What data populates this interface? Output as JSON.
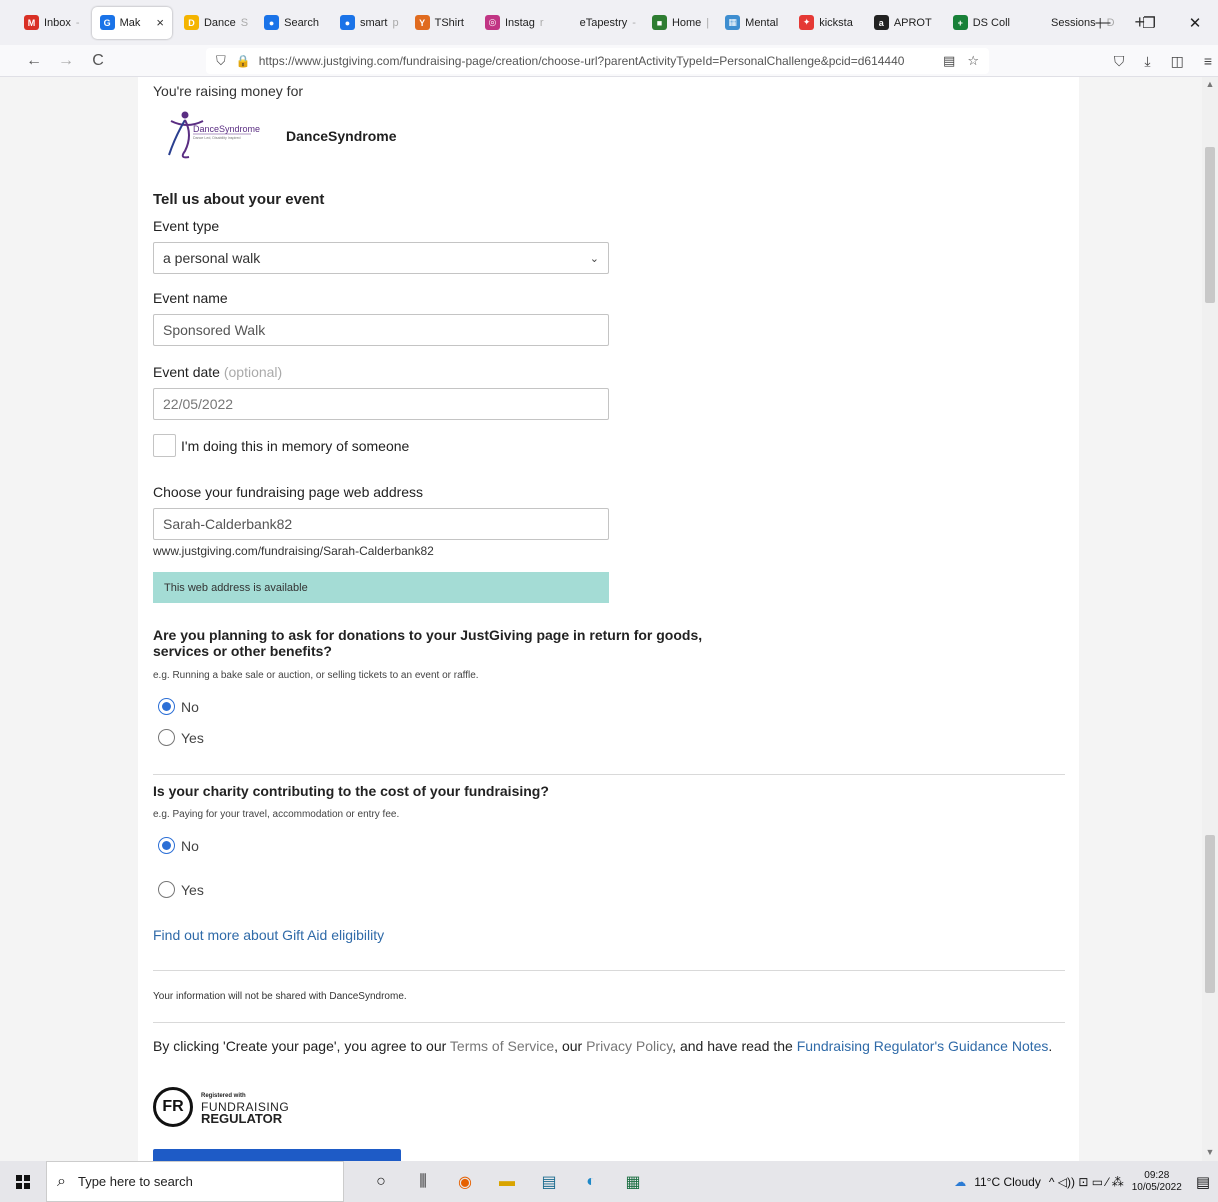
{
  "browser": {
    "tabs": [
      {
        "label": "Inbox",
        "fade": " -",
        "icon_text": "M",
        "icon_color": "#d93025",
        "active": false
      },
      {
        "label": "Mak",
        "fade": "",
        "icon_text": "G",
        "icon_color": "#1a73e8",
        "active": true
      },
      {
        "label": "Dance",
        "fade": "S",
        "icon_text": "D",
        "icon_color": "#f4b400",
        "active": false
      },
      {
        "label": "Search",
        "fade": "",
        "icon_text": "●",
        "icon_color": "#1a73e8",
        "active": false
      },
      {
        "label": "smart",
        "fade": "p",
        "icon_text": "●",
        "icon_color": "#1a73e8",
        "active": false
      },
      {
        "label": "TShirt",
        "fade": "",
        "icon_text": "Y",
        "icon_color": "#e06b1f",
        "active": false
      },
      {
        "label": "Instag",
        "fade": "r",
        "icon_text": "◎",
        "icon_color": "#c13584",
        "active": false
      },
      {
        "label": "eTapestry",
        "fade": " -",
        "icon_text": "",
        "icon_color": "#f0f0f4",
        "active": false
      },
      {
        "label": "Home",
        "fade": " |",
        "icon_text": "■",
        "icon_color": "#2e7d32",
        "active": false
      },
      {
        "label": "Mental",
        "fade": "",
        "icon_text": "▦",
        "icon_color": "#3e8ed0",
        "active": false
      },
      {
        "label": "kicksta",
        "fade": "",
        "icon_text": "✦",
        "icon_color": "#e53935",
        "active": false
      },
      {
        "label": "APROT",
        "fade": "",
        "icon_text": "a",
        "icon_color": "#222222",
        "active": false
      },
      {
        "label": "DS Coll",
        "fade": "",
        "icon_text": "+",
        "icon_color": "#188038",
        "active": false
      },
      {
        "label": "Sessions |",
        "fade": " D",
        "icon_text": "",
        "icon_color": "#f0f0f4",
        "active": false
      }
    ],
    "close_glyph": "×",
    "new_tab_glyph": "+",
    "window_controls": [
      "—",
      "❐",
      "✕"
    ],
    "url": "https://www.justgiving.com/fundraising-page/creation/choose-url?parentActivityTypeId=PersonalChallenge&pcid=d614440",
    "nav": {
      "back": "←",
      "forward": "→",
      "reload": "C"
    },
    "url_icons": {
      "shield": "⛉",
      "lock": "🔒",
      "reader": "▤",
      "star": "☆"
    },
    "right_icons": [
      "⛉",
      "⤓",
      "◫",
      "≡"
    ]
  },
  "page": {
    "raising_label": "You're raising money for",
    "charity_name": "DanceSyndrome",
    "charity_logo_text": "DanceSyndrome",
    "charity_logo_tagline": "Dance Led, Disability Inspired",
    "section_title": "Tell us about your event",
    "event_type_label": "Event type",
    "event_type_value": "a personal walk",
    "event_name_label": "Event name",
    "event_name_value": "Sponsored Walk",
    "event_date_label": "Event date",
    "event_date_optional": "(optional)",
    "event_date_value": "22/05/2022",
    "memory_label": "I'm doing this in memory of someone",
    "web_address_label": "Choose your fundraising page web address",
    "web_address_value": "Sarah-Calderbank82",
    "web_address_preview": "www.justgiving.com/fundraising/Sarah-Calderbank82",
    "availability_message": "This web address is available",
    "q1_title": "Are you planning to ask for donations to your JustGiving page in return for goods, services or other benefits?",
    "q1_example": "e.g. Running a bake sale or auction, or selling tickets to an event or raffle.",
    "q1_options": [
      {
        "label": "No",
        "selected": true
      },
      {
        "label": "Yes",
        "selected": false
      }
    ],
    "q2_title": "Is your charity contributing to the cost of your fundraising?",
    "q2_example": "e.g. Paying for your travel, accommodation or entry fee.",
    "q2_options": [
      {
        "label": "No",
        "selected": true
      },
      {
        "label": "Yes",
        "selected": false
      }
    ],
    "gift_aid_link": "Find out more about Gift Aid eligibility",
    "privacy_note": "Your information will not be shared with DanceSyndrome.",
    "terms": {
      "prefix": "By clicking 'Create your page', you agree to our ",
      "tos": "Terms of Service",
      "mid1": ", our ",
      "privacy": "Privacy Policy",
      "mid2": ", and have read the ",
      "guidance": "Fundraising Regulator's Guidance Notes",
      "suffix": "."
    },
    "regulator": {
      "mark": "FR",
      "registered": "Registered with",
      "line1": "FUNDRAISING",
      "line2": "REGULATOR"
    }
  },
  "taskbar": {
    "search_placeholder": "Type here to search",
    "search_icon": "⌕",
    "apps": [
      "○",
      "⫼",
      "◉",
      "▬",
      "▤",
      "◐",
      "▦"
    ],
    "weather": "11°C  Cloudy",
    "tray_icons": "^ ◁)) ⊡ ▭ ⁄ ⁂",
    "time": "09:28",
    "date": "10/05/2022",
    "notif_icon": "▤"
  },
  "colors": {
    "accent": "#1e5bc6",
    "link": "#2f6aa8",
    "available_bg": "#a4dcd5",
    "radio": "#2c6fd6"
  }
}
